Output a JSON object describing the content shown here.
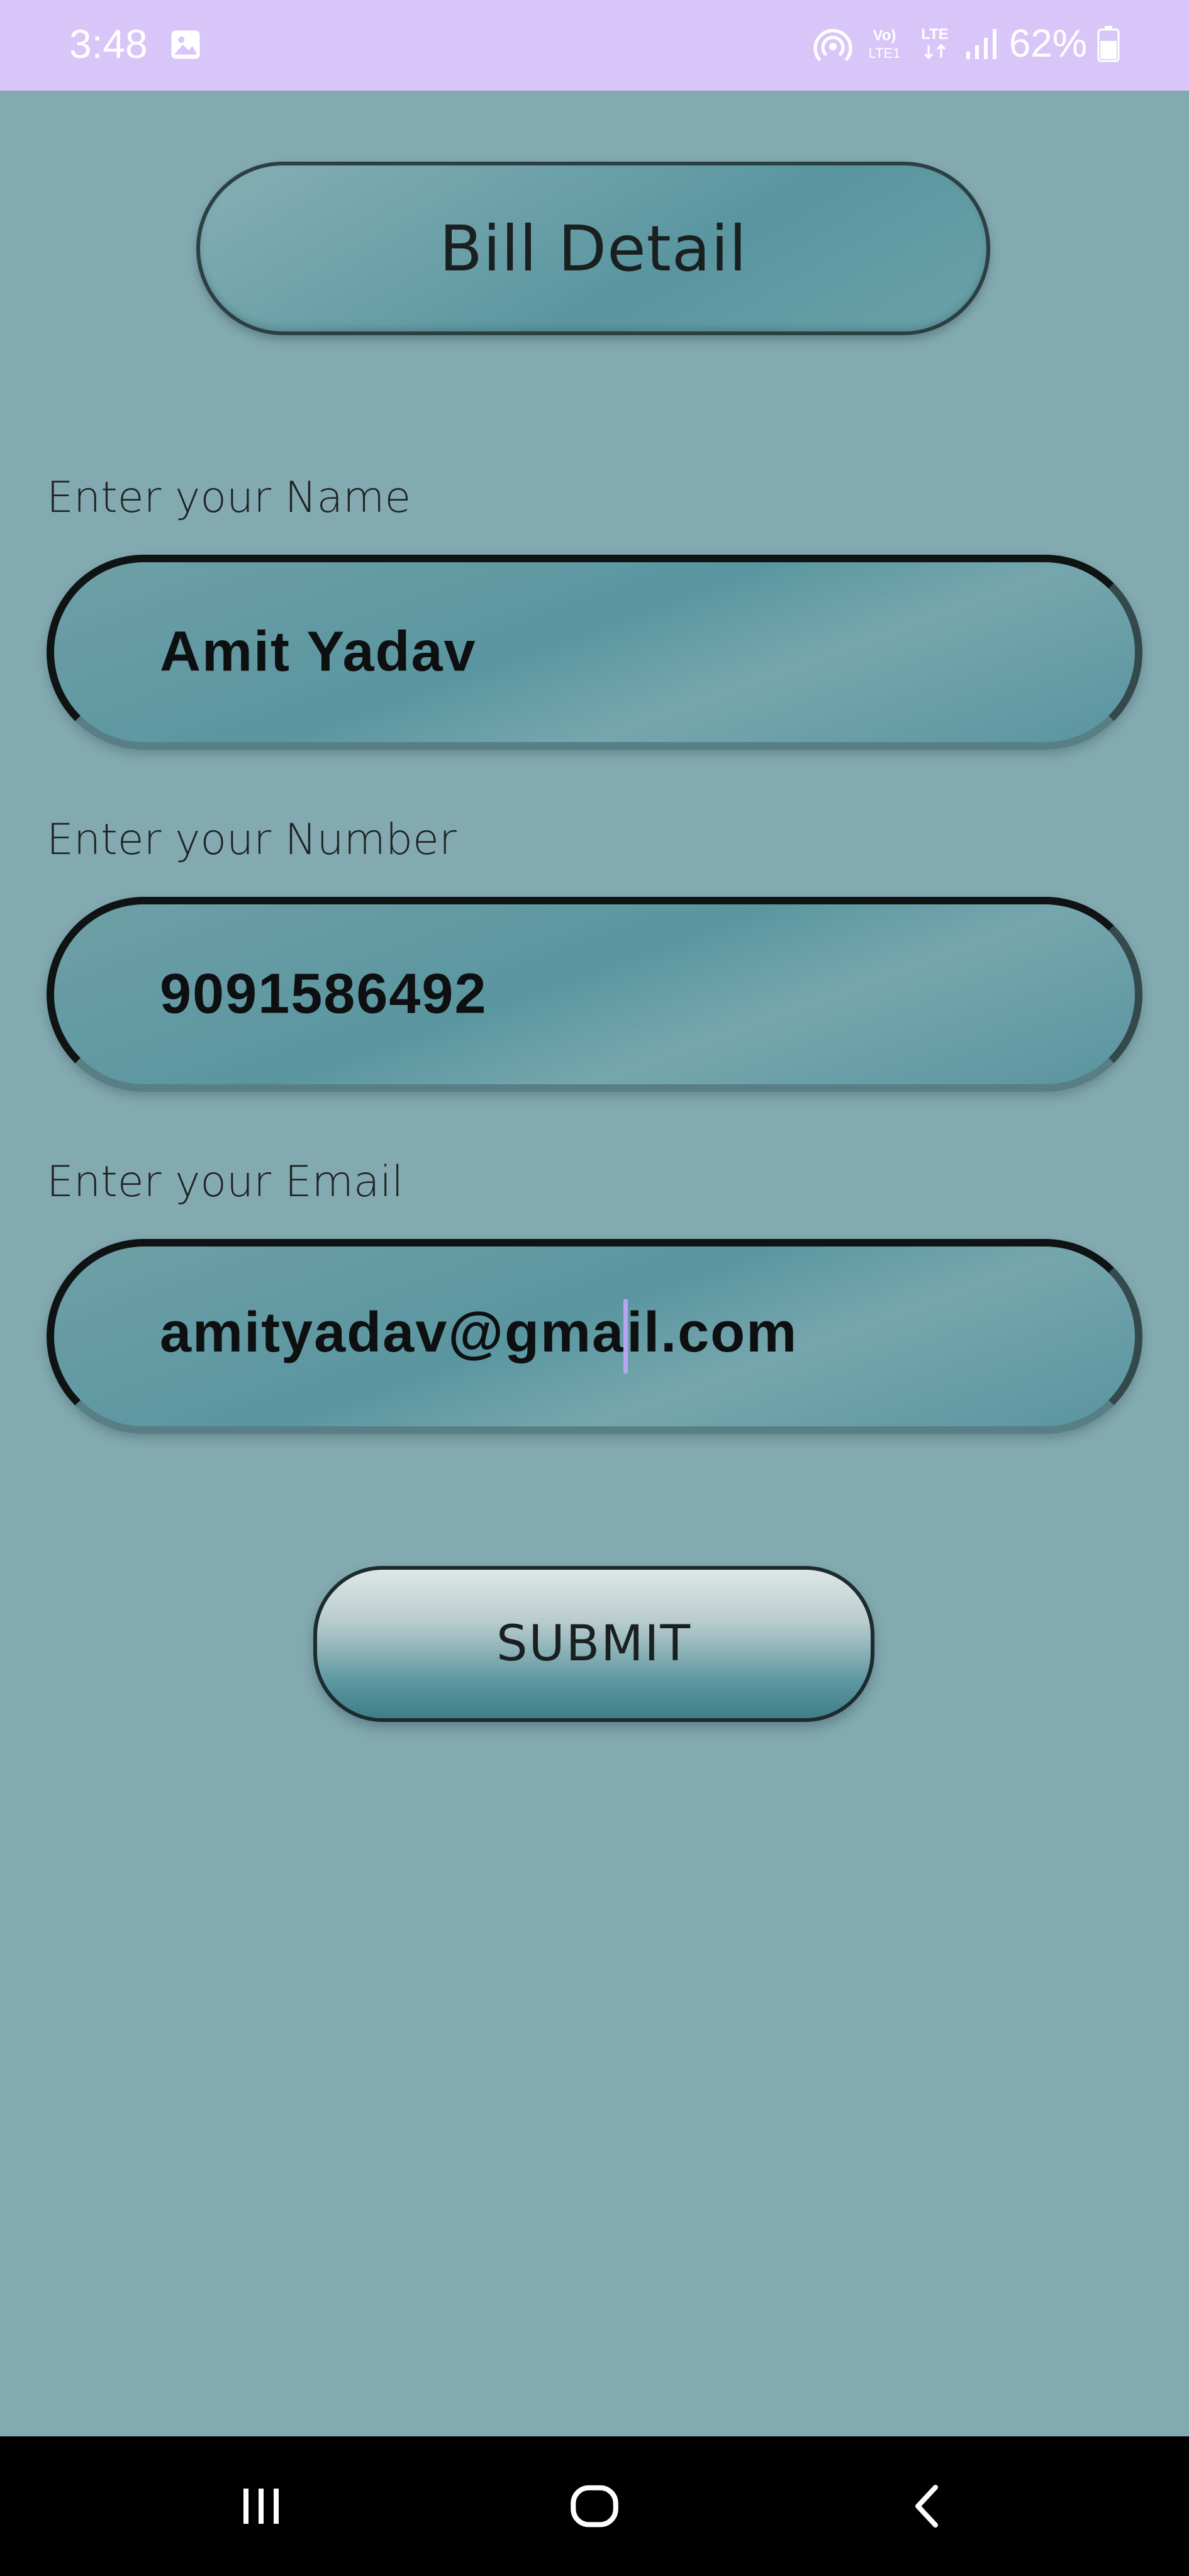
{
  "status_bar": {
    "time": "3:48",
    "battery": "62%",
    "icons": [
      "gallery-icon",
      "hotspot-icon",
      "volte-icon",
      "lte-icon",
      "signal-icon",
      "battery-icon"
    ],
    "volte_label_top": "Vo)",
    "volte_label_bottom": "LTE1",
    "lte_label": "LTE"
  },
  "header": {
    "title": "Bill Detail"
  },
  "form": {
    "name": {
      "label": "Enter your Name",
      "value": "Amit Yadav"
    },
    "number": {
      "label": "Enter your Number",
      "value": "9091586492"
    },
    "email": {
      "label": "Enter your Email",
      "value_before_cursor": "amityadav@gma",
      "value_after_cursor": "il.com"
    },
    "submit_label": "SUBMIT"
  },
  "nav_bar": {
    "buttons": [
      "recents-icon",
      "home-icon",
      "back-icon"
    ]
  },
  "colors": {
    "status_bar_bg": "#d8c6f8",
    "page_bg": "#84aab1",
    "field_bg": "#5a96a0",
    "cursor": "#b9a4f2",
    "nav_bar_bg": "#000000"
  }
}
